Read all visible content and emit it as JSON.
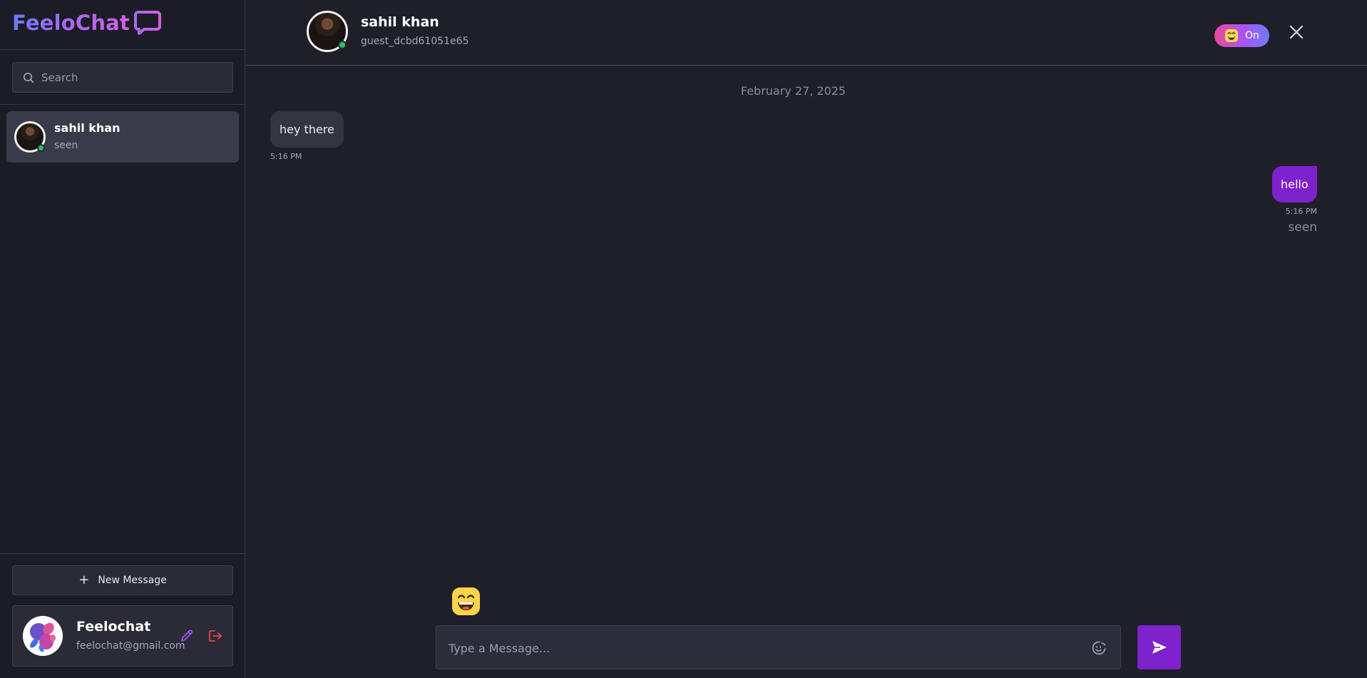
{
  "brand": {
    "name": "FeeloChat",
    "icon": "chat-bubble-icon"
  },
  "search": {
    "placeholder": "Search",
    "icon": "search-icon"
  },
  "conversations": [
    {
      "name": "sahil khan",
      "status": "seen",
      "online": true
    }
  ],
  "sidebar_footer": {
    "new_message_label": "New Message",
    "profile": {
      "name": "Feelochat",
      "email": "feelochat@gmail.com",
      "edit_icon": "pencil-icon",
      "logout_icon": "logout-icon"
    }
  },
  "chat_header": {
    "name": "sahil khan",
    "username": "guest_dcbd61051e65",
    "online": true,
    "mood_toggle_label": "On",
    "close_icon": "close-icon"
  },
  "messages": {
    "date_separator": "February 27, 2025",
    "items": [
      {
        "direction": "incoming",
        "text": "hey there",
        "time": "5:16 PM"
      },
      {
        "direction": "outgoing",
        "text": "hello",
        "time": "5:16 PM",
        "status": "seen"
      }
    ]
  },
  "composer": {
    "placeholder": "Type a Message...",
    "emoji_icon": "emoji-picker-icon",
    "send_icon": "send-icon"
  },
  "colors": {
    "background": "#1e1f29",
    "sidebar": "#1b1c26",
    "accent": "#7e22ce",
    "online": "#22c55e",
    "logout": "#ef4444",
    "edit": "#a855f7"
  }
}
